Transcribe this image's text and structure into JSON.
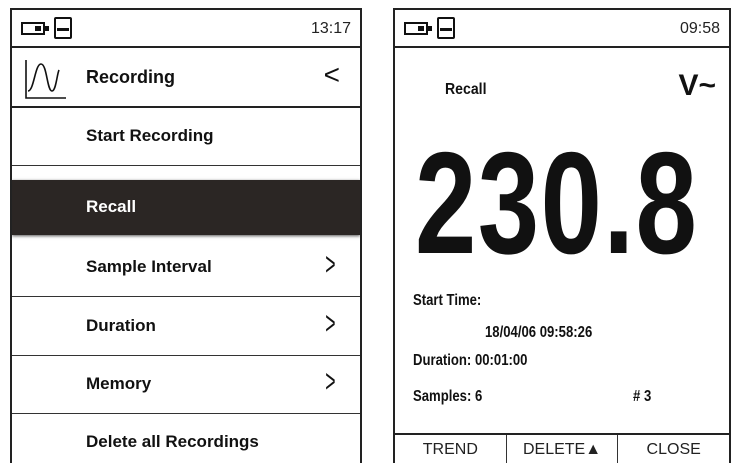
{
  "left": {
    "time": "13:17",
    "header": {
      "title": "Recording",
      "back": "<"
    },
    "items": [
      {
        "label": "Start Recording",
        "arrow": ""
      },
      {
        "label": "Recall",
        "arrow": ""
      },
      {
        "label": "Sample Interval",
        "arrow": ">"
      },
      {
        "label": "Duration",
        "arrow": ">"
      },
      {
        "label": "Memory",
        "arrow": ">"
      },
      {
        "label": "Delete all Recordings",
        "arrow": ""
      }
    ],
    "selected_index": 1
  },
  "right": {
    "time": "09:58",
    "mode_label": "Recall",
    "unit": "V~",
    "value": "230.8",
    "start_time_label": "Start Time:",
    "start_time_value": "18/04/06  09:58:26",
    "duration": "Duration: 00:01:00",
    "samples": "Samples: 6",
    "record_number": "# 3",
    "softkeys": [
      "TREND",
      "DELETE▲",
      "CLOSE"
    ]
  }
}
